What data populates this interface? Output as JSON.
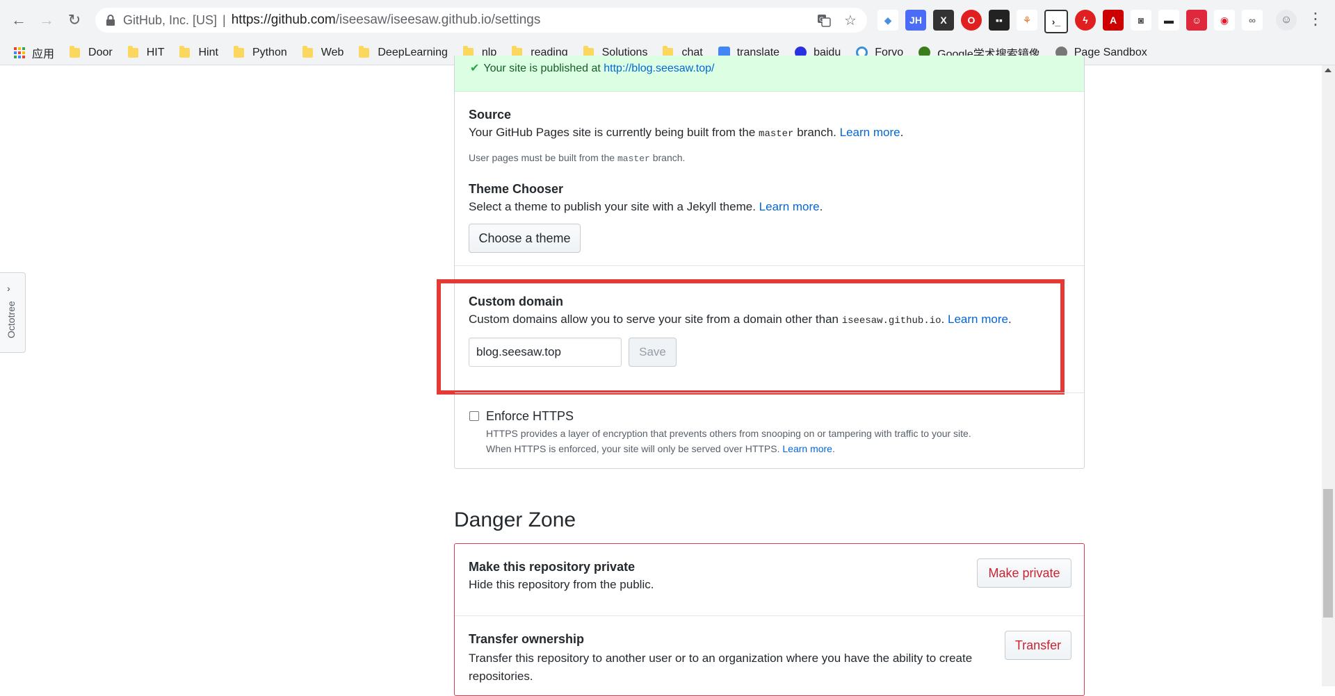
{
  "browser": {
    "site_identity": "GitHub, Inc. [US]",
    "separator": "|",
    "url_host": "https://github.com",
    "url_path": "/iseesaw/iseesaw.github.io/settings",
    "bookmarks": [
      {
        "label": "应用",
        "type": "apps"
      },
      {
        "label": "Door",
        "type": "folder"
      },
      {
        "label": "HIT",
        "type": "folder"
      },
      {
        "label": "Hint",
        "type": "folder"
      },
      {
        "label": "Python",
        "type": "folder"
      },
      {
        "label": "Web",
        "type": "folder"
      },
      {
        "label": "DeepLearning",
        "type": "folder"
      },
      {
        "label": "nlp",
        "type": "folder"
      },
      {
        "label": "reading",
        "type": "folder"
      },
      {
        "label": "Solutions",
        "type": "folder"
      },
      {
        "label": "chat",
        "type": "folder"
      },
      {
        "label": "translate",
        "type": "translate-icon"
      },
      {
        "label": "baidu",
        "type": "baidu-icon"
      },
      {
        "label": "Forvo",
        "type": "forvo-icon"
      },
      {
        "label": "Google学术搜索镜像",
        "type": "google-scholar-icon"
      },
      {
        "label": "Page Sandbox",
        "type": "globe-icon"
      }
    ]
  },
  "octotree": {
    "label": "Octotree"
  },
  "pages": {
    "published_prefix": "Your site is published at",
    "published_url": "http://blog.seesaw.top/",
    "source": {
      "title": "Source",
      "desc_prefix": "Your GitHub Pages site is currently being built from the",
      "desc_branch": "master",
      "desc_suffix": "branch.",
      "learn_more": "Learn more",
      "note_prefix": "User pages must be built from the",
      "note_branch": "master",
      "note_suffix": "branch."
    },
    "theme": {
      "title": "Theme Chooser",
      "desc": "Select a theme to publish your site with a Jekyll theme.",
      "learn_more": "Learn more",
      "button": "Choose a theme"
    },
    "custom_domain": {
      "title": "Custom domain",
      "desc_prefix": "Custom domains allow you to serve your site from a domain other than",
      "desc_domain": "iseesaw.github.io",
      "learn_more": "Learn more",
      "value": "blog.seesaw.top",
      "save": "Save"
    },
    "https": {
      "title": "Enforce HTTPS",
      "line1": "HTTPS provides a layer of encryption that prevents others from snooping on or tampering with traffic to your site.",
      "line2": "When HTTPS is enforced, your site will only be served over HTTPS.",
      "learn_more": "Learn more"
    }
  },
  "danger": {
    "title": "Danger Zone",
    "private": {
      "title": "Make this repository private",
      "desc": "Hide this repository from the public.",
      "button": "Make private"
    },
    "transfer": {
      "title": "Transfer ownership",
      "desc_line1": "Transfer this repository to another user or to an organization where you have the ability to create",
      "desc_line2": "repositories.",
      "button": "Transfer"
    }
  },
  "colors": {
    "link": "#0366d6",
    "danger": "#cb2431",
    "highlight": "#e53935",
    "success_bg": "#dcffe4"
  }
}
